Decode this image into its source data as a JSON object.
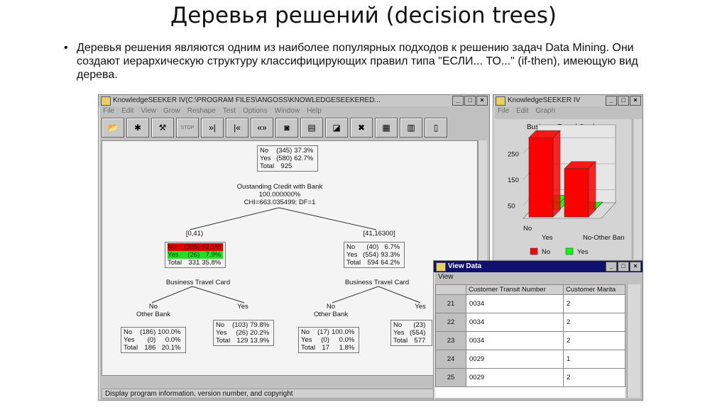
{
  "slide": {
    "title": "Деревья решений (decision trees)",
    "bullet": "Деревья решения являются одним из наиболее популярных подходов к решению задач Data Mining. Они создают иерархическую структуру классифицирующих правил типа \"ЕСЛИ... ТО...\" (if-then), имеющую вид дерева."
  },
  "main_window": {
    "title": "KnowledgeSEEKER IV(C:\\PROGRAM FILES\\ANGOSS\\KNOWLEDGESEEKERED...",
    "menu": [
      "File",
      "Edit",
      "View",
      "Grow",
      "Reshape",
      "Test",
      "Options",
      "Window",
      "Help"
    ],
    "toolbar_icons": [
      "open-folder-icon",
      "grow-icon",
      "reshape-icon",
      "stop-icon",
      "next-icon",
      "previous-icon",
      "expand-icon",
      "binoculars-icon",
      "form-icon",
      "chart-icon",
      "delete-icon",
      "tree-icon",
      "split-icon",
      "door-icon"
    ],
    "toolbar_glyphs": [
      "📂",
      "✱",
      "⚒",
      "STOP",
      "»|",
      "|«",
      "«»",
      "◙",
      "▤",
      "◪",
      "✖",
      "▦",
      "▥",
      "▯"
    ],
    "status": "Display program information, version number, and copyright",
    "tree": {
      "root": {
        "rows": [
          [
            "No",
            "(345)",
            "37.3%"
          ],
          [
            "Yes",
            "(580)",
            "62.7%"
          ],
          [
            "Total",
            "925",
            ""
          ]
        ],
        "split": "Oustanding Credit with Bank",
        "pct": "100.000000%",
        "chi": "CHI=663.035499; DF=1"
      },
      "left_range": "[0,41)",
      "right_range": "[41,16300]",
      "left": {
        "rows": [
          [
            "No",
            "(305)",
            "92.1%"
          ],
          [
            "Yes",
            "(26)",
            "7.9%"
          ],
          [
            "Total",
            "331",
            "35.8%"
          ]
        ],
        "split": "Business Travel Card"
      },
      "right": {
        "rows": [
          [
            "No",
            "(40)",
            "6.7%"
          ],
          [
            "Yes",
            "(554)",
            "93.3%"
          ],
          [
            "Total",
            "594",
            "64.2%"
          ]
        ],
        "split": "Business Travel Card"
      },
      "ll_label_a": "No",
      "ll_label_b": "Other Bank",
      "lr_label": "Yes",
      "rl_label_a": "No",
      "rl_label_b": "Other Bank",
      "rr_label": "Yes",
      "ll": {
        "rows": [
          [
            "No",
            "(186)",
            "100.0%"
          ],
          [
            "Yes",
            "(0)",
            "0.0%"
          ],
          [
            "Total",
            "186",
            "20.1%"
          ]
        ]
      },
      "lr": {
        "rows": [
          [
            "No",
            "(103)",
            "79.8%"
          ],
          [
            "Yes",
            "(26)",
            "20.2%"
          ],
          [
            "Total",
            "129",
            "13.9%"
          ]
        ]
      },
      "rl": {
        "rows": [
          [
            "No",
            "(17)",
            "100.0%"
          ],
          [
            "Yes",
            "(0)",
            "0.0%"
          ],
          [
            "Total",
            "17",
            "1.8%"
          ]
        ]
      },
      "rr": {
        "rows": [
          [
            "No",
            "(23)",
            ""
          ],
          [
            "Yes",
            "(554)",
            ""
          ],
          [
            "Total",
            "577",
            ""
          ]
        ]
      }
    }
  },
  "graph_window": {
    "title": "KnowledgeSEEKER IV",
    "menu": [
      "File",
      "Edit",
      "Graph"
    ],
    "chart_title": "Business Travel Card",
    "yticks": [
      "250",
      "150",
      "50"
    ],
    "xlabels": [
      "No",
      "Yes"
    ],
    "depth_label": "No-Other Ban",
    "legend": [
      {
        "name": "No",
        "color": "#ff0000"
      },
      {
        "name": "Yes",
        "color": "#00ff00"
      }
    ]
  },
  "chart_data": {
    "type": "bar",
    "title": "Business Travel Card",
    "categories": [
      "No",
      "Yes"
    ],
    "series": [
      {
        "name": "No",
        "values": [
          305,
          186
        ],
        "color": "#ff0000"
      },
      {
        "name": "Yes",
        "values": [
          26,
          0
        ],
        "color": "#00ff00"
      }
    ],
    "ylim": [
      0,
      300
    ],
    "yticks": [
      50,
      150,
      250
    ],
    "legend": "bottom"
  },
  "view_data": {
    "title": "View Data",
    "menu": [
      "View"
    ],
    "columns": [
      "",
      "Customer Transit Number",
      "Customer Marita"
    ],
    "rows": [
      [
        "21",
        "0034",
        "2"
      ],
      [
        "22",
        "0034",
        "2"
      ],
      [
        "23",
        "0034",
        "2"
      ],
      [
        "24",
        "0029",
        "1"
      ],
      [
        "25",
        "0029",
        "2"
      ]
    ]
  }
}
